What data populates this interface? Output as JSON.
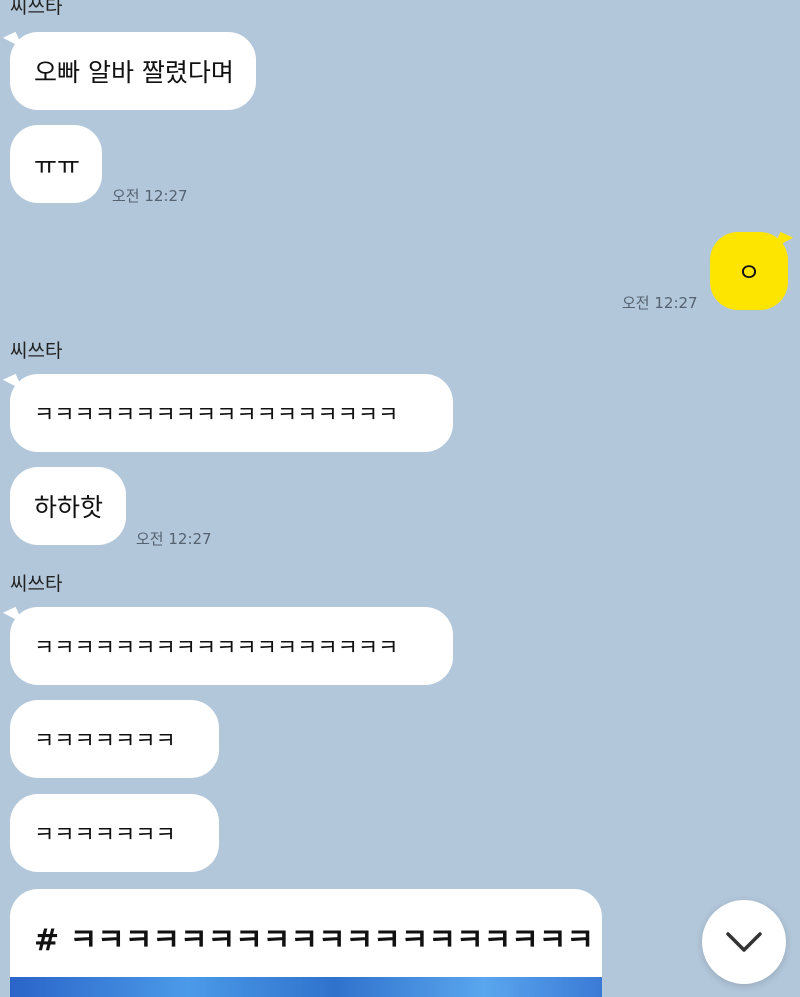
{
  "chat": {
    "groups": [
      {
        "sender": "씨쓰타",
        "messages": [
          "오빠 알바 짤렸다며",
          "ㅠㅠ"
        ],
        "time": "오전 12:27"
      },
      {
        "mine": true,
        "messages": [
          "ㅇ"
        ],
        "time": "오전 12:27"
      },
      {
        "sender": "씨쓰타",
        "messages": [
          "ㅋㅋㅋㅋㅋㅋㅋㅋㅋㅋㅋㅋㅋㅋㅋㅋㅋㅋ",
          "하하핫"
        ],
        "time": "오전 12:27"
      },
      {
        "sender": "씨쓰타",
        "messages": [
          "ㅋㅋㅋㅋㅋㅋㅋㅋㅋㅋㅋㅋㅋㅋㅋㅋㅋㅋ",
          "ㅋㅋㅋㅋㅋㅋㅋ",
          "ㅋㅋㅋㅋㅋㅋㅋ"
        ],
        "link_card_title": "# ㅋㅋㅋㅋㅋㅋㅋㅋㅋㅋㅋㅋㅋㅋㅋㅋㅋㅋㅋ"
      }
    ]
  },
  "controls": {
    "scroll_down_icon": "chevron-down-icon"
  },
  "colors": {
    "background": "#b2c7da",
    "my_bubble": "#fee500",
    "other_bubble": "#ffffff"
  }
}
